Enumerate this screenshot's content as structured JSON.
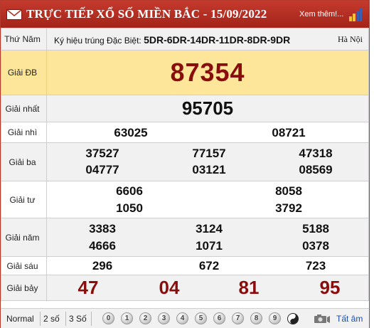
{
  "header": {
    "title": "TRỰC TIẾP XỔ SỐ MIỀN BẮC - 15/09/2022",
    "more_link": "Xem thêm!..."
  },
  "info": {
    "label": "Thứ Năm",
    "code_prefix": "Ký hiệu trúng Đặc Biệt:",
    "code": "5DR-6DR-14DR-11DR-8DR-9DR",
    "location": "Hà Nội"
  },
  "prizes": {
    "special": {
      "label": "Giải ĐB",
      "numbers": [
        "87354"
      ]
    },
    "first": {
      "label": "Giải nhất",
      "numbers": [
        "95705"
      ]
    },
    "second": {
      "label": "Giải nhì",
      "numbers": [
        "63025",
        "08721"
      ]
    },
    "third": {
      "label": "Giải ba",
      "numbers": [
        "37527",
        "77157",
        "47318",
        "04777",
        "03121",
        "08569"
      ]
    },
    "fourth": {
      "label": "Giải tư",
      "numbers": [
        "6606",
        "8058",
        "1050",
        "3792"
      ]
    },
    "fifth": {
      "label": "Giải năm",
      "numbers": [
        "3383",
        "3124",
        "5188",
        "4666",
        "1071",
        "0378"
      ]
    },
    "sixth": {
      "label": "Giải sáu",
      "numbers": [
        "296",
        "672",
        "723"
      ]
    },
    "seventh": {
      "label": "Giải bảy",
      "numbers": [
        "47",
        "04",
        "81",
        "95"
      ]
    }
  },
  "footer": {
    "normal": "Normal",
    "two_digit": "2 số",
    "three_digit": "3 Số",
    "digits": [
      "0",
      "1",
      "2",
      "3",
      "4",
      "5",
      "6",
      "7",
      "8",
      "9"
    ],
    "all_label": "Tất âm"
  },
  "colors": {
    "header_red": "#b02d20",
    "special_bg": "#fde59a",
    "highlight_number": "#8a0d0d",
    "link_blue": "#1a4ea8"
  }
}
